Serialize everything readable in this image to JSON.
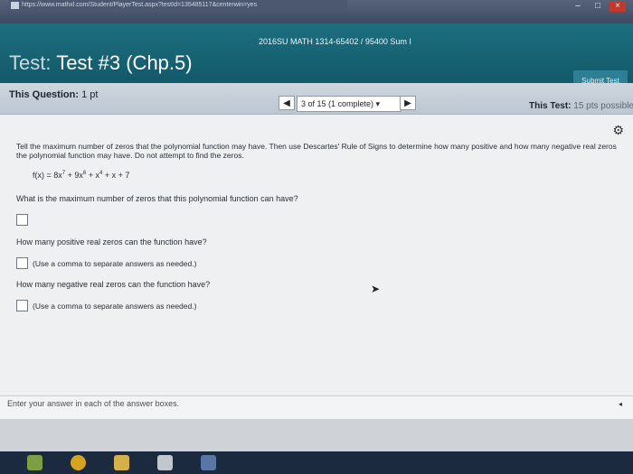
{
  "browser": {
    "url": "https://www.mathxl.com/Student/PlayerTest.aspx?testId=135485117&centerwin=yes",
    "min_icon": "minimize-icon",
    "max_icon": "maximize-icon",
    "close_icon": "close-icon",
    "min_glyph": "–",
    "max_glyph": "□",
    "close_glyph": "×"
  },
  "header": {
    "course": "2016SU MATH 1314-65402 / 95400 Sum I",
    "test_label": "Test:",
    "test_name": "Test #3 (Chp.5)",
    "submit_label": "Submit Test"
  },
  "question_bar": {
    "this_question_label": "This Question:",
    "this_question_value": "1 pt",
    "prev_glyph": "◀",
    "next_glyph": "▶",
    "progress": "3 of 15 (1 complete) ▾",
    "this_test_label": "This Test:",
    "this_test_value": "15 pts possible"
  },
  "content": {
    "gear_glyph": "⚙",
    "instructions": "Tell the maximum number of zeros that the polynomial function may have. Then use Descartes' Rule of Signs to determine how many positive and how many negative real zeros the polynomial function may have. Do not attempt to find the zeros.",
    "function": {
      "prefix": "f(x) = 8x",
      "e1": "7",
      "t2": " + 9x",
      "e2": "6",
      "t3": " + x",
      "e3": "4",
      "rest": " + x + 7"
    },
    "q1": "What is the maximum number of zeros that this polynomial function can have?",
    "q2": "How many positive real zeros can the function have?",
    "hint2": "(Use a comma to separate answers as needed.)",
    "q3": "How many negative real zeros can the function have?",
    "hint3": "(Use a comma to separate answers as needed.)",
    "cursor_glyph": "➤"
  },
  "footer": {
    "enter_text": "Enter your answer in each of the answer boxes.",
    "arrow_glyph": "◂"
  },
  "colors": {
    "header_teal": "#1d6f80",
    "info_bar": "#cfd6de",
    "content_bg": "#eef0f2",
    "taskbar": "#1c2a3f"
  }
}
